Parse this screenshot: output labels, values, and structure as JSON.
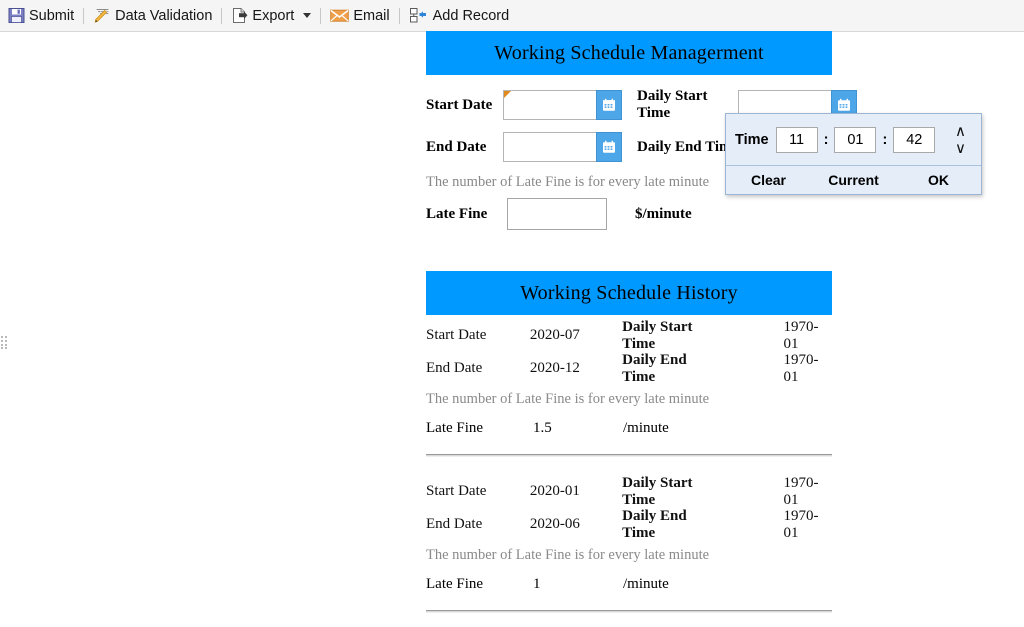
{
  "toolbar": {
    "items": [
      {
        "label": "Submit",
        "icon": "save-floppy-icon"
      },
      {
        "label": "Data Validation",
        "icon": "pen-validation-icon"
      },
      {
        "label": "Export",
        "icon": "export-document-icon",
        "has_caret": true
      },
      {
        "label": "Email",
        "icon": "envelope-icon"
      },
      {
        "label": "Add Record",
        "icon": "add-record-icon"
      }
    ]
  },
  "management_card": {
    "title": "Working Schedule Managerment",
    "fields": {
      "start_date_label": "Start Date",
      "start_date_value": "",
      "end_date_label": "End Date",
      "end_date_value": "",
      "daily_start_time_label": "Daily Start Time",
      "daily_start_time_value": "",
      "daily_end_time_label": "Daily End Time",
      "daily_end_time_value": "",
      "late_fine_label": "Late Fine",
      "late_fine_value": "",
      "late_fine_unit": "$/minute"
    },
    "hint": "The number of Late Fine is for every late minute"
  },
  "time_picker": {
    "title": "Time",
    "hour": "11",
    "minute": "01",
    "second": "42",
    "separator": ":",
    "up_icon": "∧",
    "down_icon": "∨",
    "clear_label": "Clear",
    "current_label": "Current",
    "ok_label": "OK"
  },
  "history_card": {
    "title": "Working Schedule History",
    "note": "The number of Late Fine is for every late minute",
    "labels": {
      "start_date": "Start Date",
      "end_date": "End Date",
      "daily_start_time": "Daily Start Time",
      "daily_end_time": "Daily End Time",
      "late_fine": "Late Fine",
      "late_fine_unit": "/minute"
    },
    "records": [
      {
        "start_date": "2020-07",
        "end_date": "2020-12",
        "daily_start_time": "1970-01",
        "daily_end_time": "1970-01",
        "late_fine": "1.5"
      },
      {
        "start_date": "2020-01",
        "end_date": "2020-06",
        "daily_start_time": "1970-01",
        "daily_end_time": "1970-01",
        "late_fine": "1"
      }
    ]
  },
  "colors": {
    "header_blue": "#0099ff",
    "toolbar_bg": "#f5f5f5",
    "picker_bg": "#e4edf8",
    "calendar_btn": "#4da6e8",
    "hint_gray": "#888888"
  }
}
